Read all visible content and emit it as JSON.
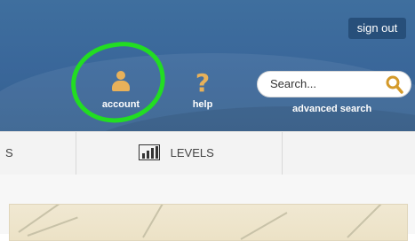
{
  "header": {
    "sign_out_label": "sign out",
    "account_label": "account",
    "help_label": "help",
    "search": {
      "placeholder": "Search...",
      "advanced_label": "advanced search"
    }
  },
  "tabs": [
    {
      "label": "S"
    },
    {
      "label": "LEVELS"
    },
    {
      "label": ""
    }
  ],
  "colors": {
    "header_blue": "#3a679a",
    "icon_gold": "#e8b15a",
    "highlight_green": "#22dd22",
    "tabbar_bg": "#f3f3f3"
  },
  "icons": {
    "account": "person-icon",
    "help": "question-mark-icon",
    "search": "magnifier-icon",
    "levels": "books-icon"
  }
}
